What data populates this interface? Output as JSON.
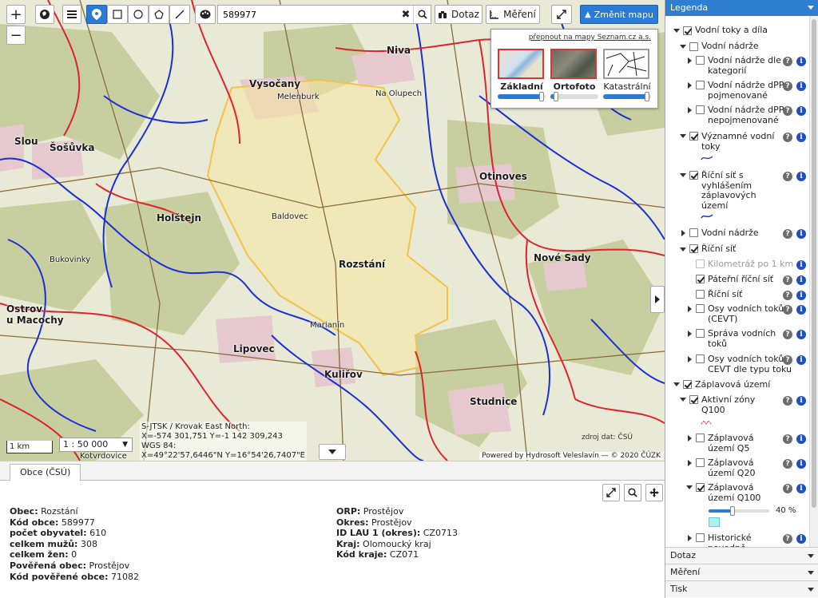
{
  "toolbar": {
    "zoom_in": "+",
    "zoom_out": "−",
    "search_value": "589977",
    "dotaz_label": "Dotaz",
    "mereni_label": "Měření",
    "change_map_label": "Změnit mapu"
  },
  "basemaps": {
    "switch_link": "přepnout na mapy Seznam.cz a.s.",
    "items": [
      {
        "label": "Základní",
        "opacity": 0.95
      },
      {
        "label": "Ortofoto",
        "opacity": 0.12
      },
      {
        "label": "Katastrální",
        "opacity": 0.95
      }
    ]
  },
  "map": {
    "scale_bar": "1 km",
    "scale_select": "1 : 50 000",
    "coords": {
      "line1": "S-JTSK / Krovak East North:",
      "line2": "X=-574 301,751 Y=-1 142 309,243",
      "line3": "WGS 84:",
      "line4": "X=49°22'57,6446\"N Y=16°54'26,7407\"E"
    },
    "data_source": "zdroj dat: ČSÚ",
    "attribution": "Powered by Hydrosoft Veleslavín — © 2020 ČÚZK",
    "labels": {
      "niva": "Niva",
      "vysocany": "Vysočany",
      "melenburk": "Melenburk",
      "zakladni_lbl": "Základní",
      "slou": "Slou",
      "sosuvka": "Šošůvka",
      "holstejn": "Holštejn",
      "otinoves": "Otinoves",
      "rozstani": "Rozstání",
      "nove_sady": "Nové Sady",
      "ostrov": "Ostrov",
      "u_macochy": "u Macochy",
      "lipovec": "Lipovec",
      "kulirov": "Kuliřov",
      "studnice": "Studnice",
      "kotvrdovice": "Kotvrdovice",
      "bukovinky": "Bukovinky",
      "na_olupech": "Na Olupech",
      "baldovec": "Baldovec",
      "marianin": "Marianín"
    }
  },
  "bottom": {
    "tab_label": "Obce (ČSÚ)",
    "left_rows": [
      {
        "key": "Obec:",
        "value": "Rozstání"
      },
      {
        "key": "Kód obce:",
        "value": "589977"
      },
      {
        "key": "počet obyvatel:",
        "value": "610"
      },
      {
        "key": "celkem mužů:",
        "value": "308"
      },
      {
        "key": "celkem žen:",
        "value": "0"
      },
      {
        "key": "Pověřená obec:",
        "value": "Prostějov"
      },
      {
        "key": "Kód pověřené obce:",
        "value": "71082"
      }
    ],
    "right_rows": [
      {
        "key": "ORP:",
        "value": "Prostějov"
      },
      {
        "key": "Okres:",
        "value": "Prostějov"
      },
      {
        "key": "ID LAU 1 (okres):",
        "value": "CZ0713"
      },
      {
        "key": "Kraj:",
        "value": "Olomoucký kraj"
      },
      {
        "key": "Kód kraje:",
        "value": "CZ071"
      }
    ]
  },
  "legend": {
    "title": "Legenda",
    "items": {
      "vodni_toky_dila": "Vodní toky a díla",
      "vodni_nadrze": "Vodní nádrže",
      "vn_kategorii": "Vodní nádrže dle kategorií",
      "vn_dpp_poj": "Vodní nádrže dPP - pojmenované",
      "vn_dpp_nepoj": "Vodní nádrže dPP - nepojmenované",
      "vyznamne_toky": "Významné vodní toky",
      "ricni_sit_zaplav": "Říční síť s vyhlášením záplavových území",
      "vodni_nadrze2": "Vodní nádrže",
      "ricni_sit": "Říční síť",
      "kilometraz": "Kilometráž po 1 km",
      "pateri": "Páteřní říční síť",
      "ricni_sit2": "Říční síť",
      "osy_cevt": "Osy vodních toků (CEVT)",
      "sprava": "Správa vodních toků",
      "osy_typ": "Osy vodních toků CEVT dle typu toku",
      "zaplavova": "Záplavová území",
      "aktivni": "Aktivní zóny Q100",
      "q5": "Záplavová území Q5",
      "q20": "Záplavová území Q20",
      "q100": "Záplavová území Q100",
      "q100_opacity": "40 %",
      "historicke": "Historické povodně"
    },
    "q100_slider": 0.4,
    "accordions": [
      "Dotaz",
      "Měření",
      "Tisk"
    ]
  },
  "colors": {
    "accent": "#2f7fd0",
    "river": "#1a2fd6",
    "boundary": "#e0232d",
    "municipality": "#f5c24a"
  }
}
